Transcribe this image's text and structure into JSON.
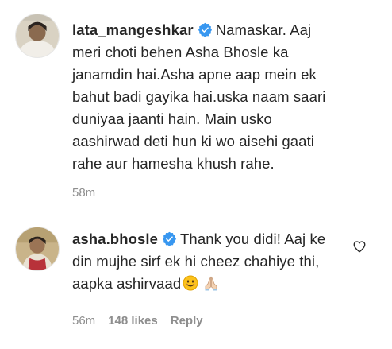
{
  "comments": [
    {
      "username": "lata_mangeshkar",
      "verified": true,
      "text": "Namaskar. Aaj meri choti behen Asha Bhosle ka janamdin hai.Asha apne aap mein ek bahut badi gayika hai.uska naam saari duniyaa jaanti hain. Main usko aashirwad deti hun ki wo aisehi gaati rahe aur hamesha khush rahe.",
      "time": "58m"
    },
    {
      "username": "asha.bhosle",
      "verified": true,
      "text": "Thank you didi! Aaj ke din mujhe sirf ek hi cheez chahiye thi, aapka ashirvaad",
      "emojis": [
        "smiling-face-icon",
        "folded-hands-icon"
      ],
      "time": "56m",
      "likes": "148 likes",
      "reply_label": "Reply"
    }
  ],
  "colors": {
    "text": "#262626",
    "meta": "#8e8e8e",
    "verified": "#3897f0"
  }
}
